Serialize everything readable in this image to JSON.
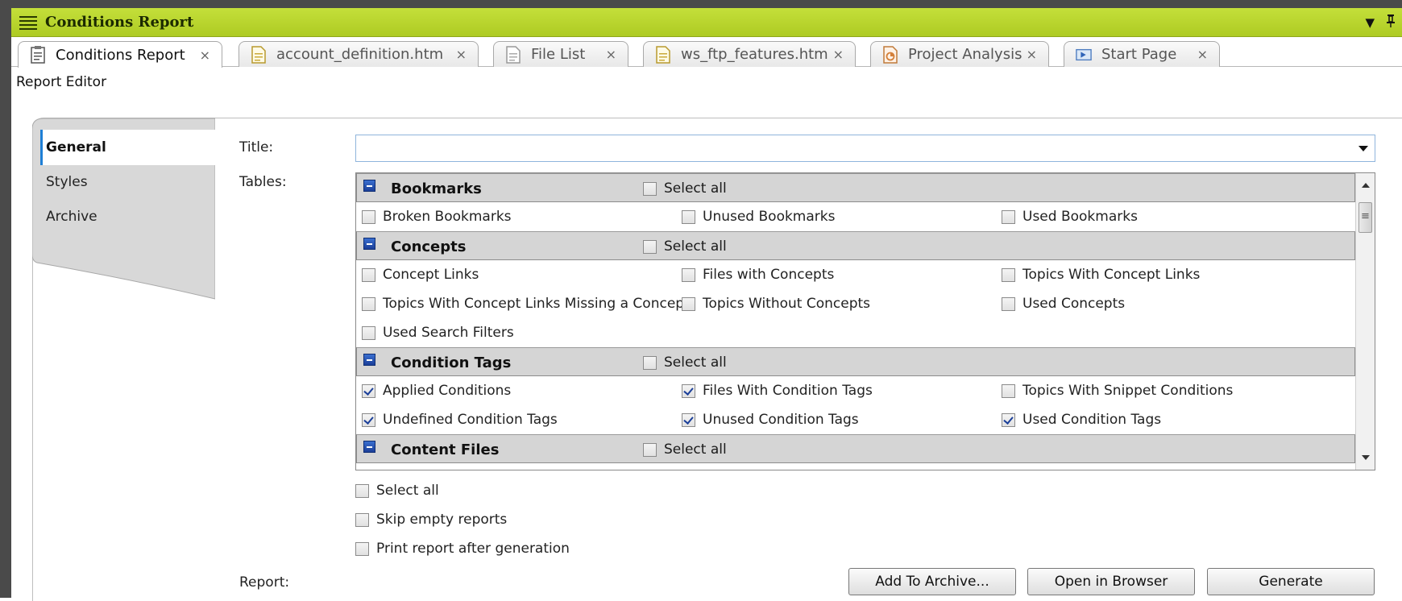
{
  "window": {
    "title": "Conditions Report",
    "accent": "#aecb23"
  },
  "tabs": [
    {
      "label": "Conditions Report",
      "icon": "report-icon",
      "active": true
    },
    {
      "label": "account_definition.htm",
      "icon": "html-file-icon",
      "active": false
    },
    {
      "label": "File List",
      "icon": "file-list-icon",
      "active": false
    },
    {
      "label": "ws_ftp_features.htm",
      "icon": "html-file-icon",
      "active": false
    },
    {
      "label": "Project Analysis",
      "icon": "analysis-icon",
      "active": false
    },
    {
      "label": "Start Page",
      "icon": "start-page-icon",
      "active": false
    }
  ],
  "tab_close_glyph": "×",
  "editor": {
    "heading": "Report Editor",
    "nav": [
      "General",
      "Styles",
      "Archive"
    ],
    "title_label": "Title:",
    "title_value": "",
    "tables_label": "Tables:",
    "report_label": "Report:"
  },
  "table_groups": [
    {
      "name": "Bookmarks",
      "select_all": "Select all",
      "select_all_checked": false,
      "rows": [
        [
          {
            "label": "Broken Bookmarks",
            "checked": false
          },
          {
            "label": "Unused Bookmarks",
            "checked": false
          },
          {
            "label": "Used Bookmarks",
            "checked": false
          }
        ]
      ]
    },
    {
      "name": "Concepts",
      "select_all": "Select all",
      "select_all_checked": false,
      "rows": [
        [
          {
            "label": "Concept Links",
            "checked": false
          },
          {
            "label": "Files with Concepts",
            "checked": false
          },
          {
            "label": "Topics With Concept Links",
            "checked": false
          }
        ],
        [
          {
            "label": "Topics With Concept Links Missing a Concept",
            "checked": false
          },
          {
            "label": "Topics Without Concepts",
            "checked": false
          },
          {
            "label": "Used Concepts",
            "checked": false
          }
        ],
        [
          {
            "label": "Used Search Filters",
            "checked": false
          }
        ]
      ]
    },
    {
      "name": "Condition Tags",
      "select_all": "Select all",
      "select_all_checked": false,
      "rows": [
        [
          {
            "label": "Applied Conditions",
            "checked": true
          },
          {
            "label": "Files With Condition Tags",
            "checked": true
          },
          {
            "label": "Topics With Snippet Conditions",
            "checked": false
          }
        ],
        [
          {
            "label": "Undefined Condition Tags",
            "checked": true
          },
          {
            "label": "Unused Condition Tags",
            "checked": true
          },
          {
            "label": "Used Condition Tags",
            "checked": true
          }
        ]
      ]
    },
    {
      "name": "Content Files",
      "select_all": "Select all",
      "select_all_checked": false,
      "rows": []
    }
  ],
  "options": [
    {
      "label": "Select all",
      "checked": false
    },
    {
      "label": "Skip empty reports",
      "checked": false
    },
    {
      "label": "Print report after generation",
      "checked": false
    }
  ],
  "buttons": {
    "add_to_archive": "Add To Archive...",
    "open_in_browser": "Open in Browser",
    "generate": "Generate"
  }
}
